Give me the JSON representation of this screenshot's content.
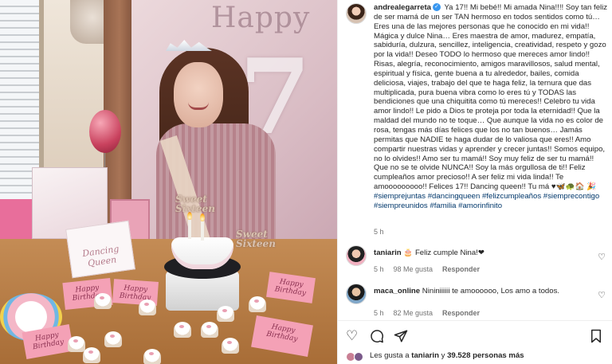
{
  "post": {
    "author": "andrealegarreta",
    "verified_mark": "✓",
    "caption_body": "Ya 17!! Mi bebé!! Mi amada Nina!!!! Soy tan feliz de ser mamá de un ser TAN hermoso en todos sentidos como tú… Eres una de las mejores personas que he conocido en mi vida!! Mágica y dulce Nina… Eres maestra de amor, madurez, empatía, sabiduría, dulzura, sencillez, inteligencia, creatividad, respeto y gozo por la vida!! Deseo TODO lo hermoso que mereces amor lindo!! Risas, alegría, reconocimiento, amigos maravillosos, salud mental, espiritual y física, gente buena a tu alrededor, bailes, comida deliciosa, viajes, trabajo del que te haga feliz, la ternura que das multiplicada, pura buena vibra como lo eres tú y TODAS las bendiciones que una chiquitita como tú mereces!! Celebro tu vida amor lindo!! Le pido a Dios te proteja por toda la eternidad!! Que la maldad del mundo no te toque… Que aunque la vida no es color de rosa, tengas más días felices que los no tan buenos… Jamás permitas que NADIE te haga dudar de lo valiosa que eres!! Amo compartir nuestras vidas y aprender y crecer juntas!! Somos equipo, no lo olvides!! Amo ser tu mamá!! Soy muy feliz de ser tu mamá!! Que no se te olvide NUNCA!! Soy la más orgullosa de ti!! Feliz cumpleaños amor precioso!! A ser feliz mi vida linda!! Te amooooooooo!! Felices 17!! Dancing queen!! Tu má ♥🦋🐢🏠",
    "caption_hashtags": "🎉#siemprejuntas #dancingqueen #felizcumpleaños #siemprecontigo #siempreunidos #familia #amorinfinito",
    "time": "5 h"
  },
  "comments": [
    {
      "author": "taniarin",
      "text": "🎂 Feliz cumple Nina!❤",
      "time": "5 h",
      "likes": "98 Me gusta",
      "reply_label": "Responder"
    },
    {
      "author": "maca_online",
      "text": "Nininiiiiii te amoooooo, Los amo a todos.",
      "time": "5 h",
      "likes": "82 Me gusta",
      "reply_label": "Responder"
    }
  ],
  "actions": {
    "like_icon": "heart-outline-icon",
    "comment_icon": "comment-bubble-icon",
    "share_icon": "paper-plane-icon",
    "save_icon": "bookmark-icon"
  },
  "likes_summary": {
    "prefix": "Les gusta a",
    "user": "taniarin",
    "conjunction": "y",
    "count": "39.528 personas más"
  },
  "media": {
    "banner_text": "Happy",
    "banner_number": "7",
    "cake_topper": "Sweet Sixteen",
    "card_text": "Dancing Queen",
    "napkin_text": "Happy Birthday"
  },
  "colors": {
    "text": "#262626",
    "secondary": "#737373",
    "verified": "#3897f0",
    "hashtag": "#00376b"
  }
}
